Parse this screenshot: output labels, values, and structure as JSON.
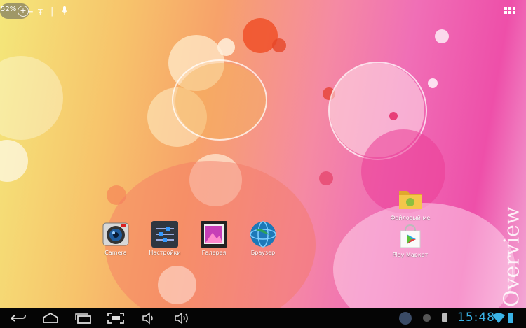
{
  "status_bar": {
    "battery": "52%",
    "icons": [
      "plus-circle-icon",
      "usb-icon",
      "debug-icon",
      "mic-icon"
    ]
  },
  "apps_button": {
    "icon": "all-apps-icon"
  },
  "apps": [
    {
      "label": "Camera",
      "icon": "camera-icon"
    },
    {
      "label": "Настройки",
      "icon": "settings-icon"
    },
    {
      "label": "Галерея",
      "icon": "gallery-icon"
    },
    {
      "label": "Браузер",
      "icon": "browser-icon"
    },
    {
      "label": "Файловый ме",
      "icon": "file-manager-icon"
    },
    {
      "label": "Play Маркет",
      "icon": "play-store-icon"
    }
  ],
  "navbar": {
    "buttons": [
      "back-icon",
      "home-icon",
      "recents-icon",
      "screenshot-icon",
      "volume-down-icon",
      "volume-up-icon"
    ],
    "clock": "15:48"
  },
  "watermark": "Overview"
}
